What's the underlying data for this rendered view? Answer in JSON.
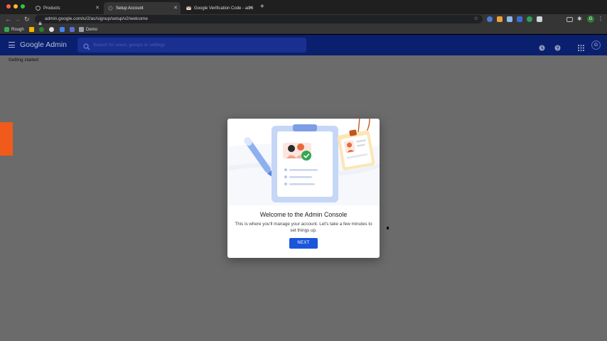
{
  "browser": {
    "tabs": [
      {
        "title": "Products",
        "active": false
      },
      {
        "title": "Setup Account",
        "active": true
      },
      {
        "title": "Google Verification Code - adm",
        "active": false
      }
    ],
    "url": "admin.google.com/u/2/ac/signup/setup/v2/welcome",
    "bookmarks": [
      {
        "label": "Rough"
      },
      {
        "label": "Demo"
      }
    ],
    "profile_initial": "G"
  },
  "app": {
    "title": "Google Admin",
    "search_placeholder": "Search for users, groups or settings",
    "avatar_initial": "G",
    "breadcrumb": "Getting started"
  },
  "dialog": {
    "title": "Welcome to the Admin Console",
    "body": "This is where you'll manage your account. Let's take a few minutes to set things up.",
    "next_label": "NEXT"
  },
  "colors": {
    "header": "#0a1f6e",
    "accent": "#1a56db",
    "side_tab": "#f05a1a"
  }
}
